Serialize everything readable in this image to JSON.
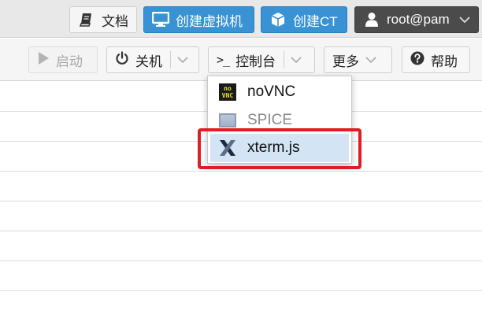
{
  "topbar": {
    "docs_label": "文档",
    "create_vm_label": "创建虚拟机",
    "create_ct_label": "创建CT",
    "user_label": "root@pam"
  },
  "toolbar": {
    "start_label": "启动",
    "shutdown_label": "关机",
    "console_prompt": ">_",
    "console_label": "控制台",
    "more_label": "更多",
    "help_label": "帮助"
  },
  "console_menu": {
    "items": [
      {
        "label": "noVNC",
        "icon": "novnc-icon",
        "logo_text": [
          "no",
          "VNC"
        ],
        "state": "normal"
      },
      {
        "label": "SPICE",
        "icon": "spice-icon",
        "state": "disabled"
      },
      {
        "label": "xterm.js",
        "icon": "xterm-icon",
        "state": "hover"
      }
    ]
  },
  "colors": {
    "primary_blue": "#3892d4",
    "user_dark": "#4b4b4b",
    "highlight_red": "#e11d24",
    "menu_hover": "#d3e4f5"
  }
}
